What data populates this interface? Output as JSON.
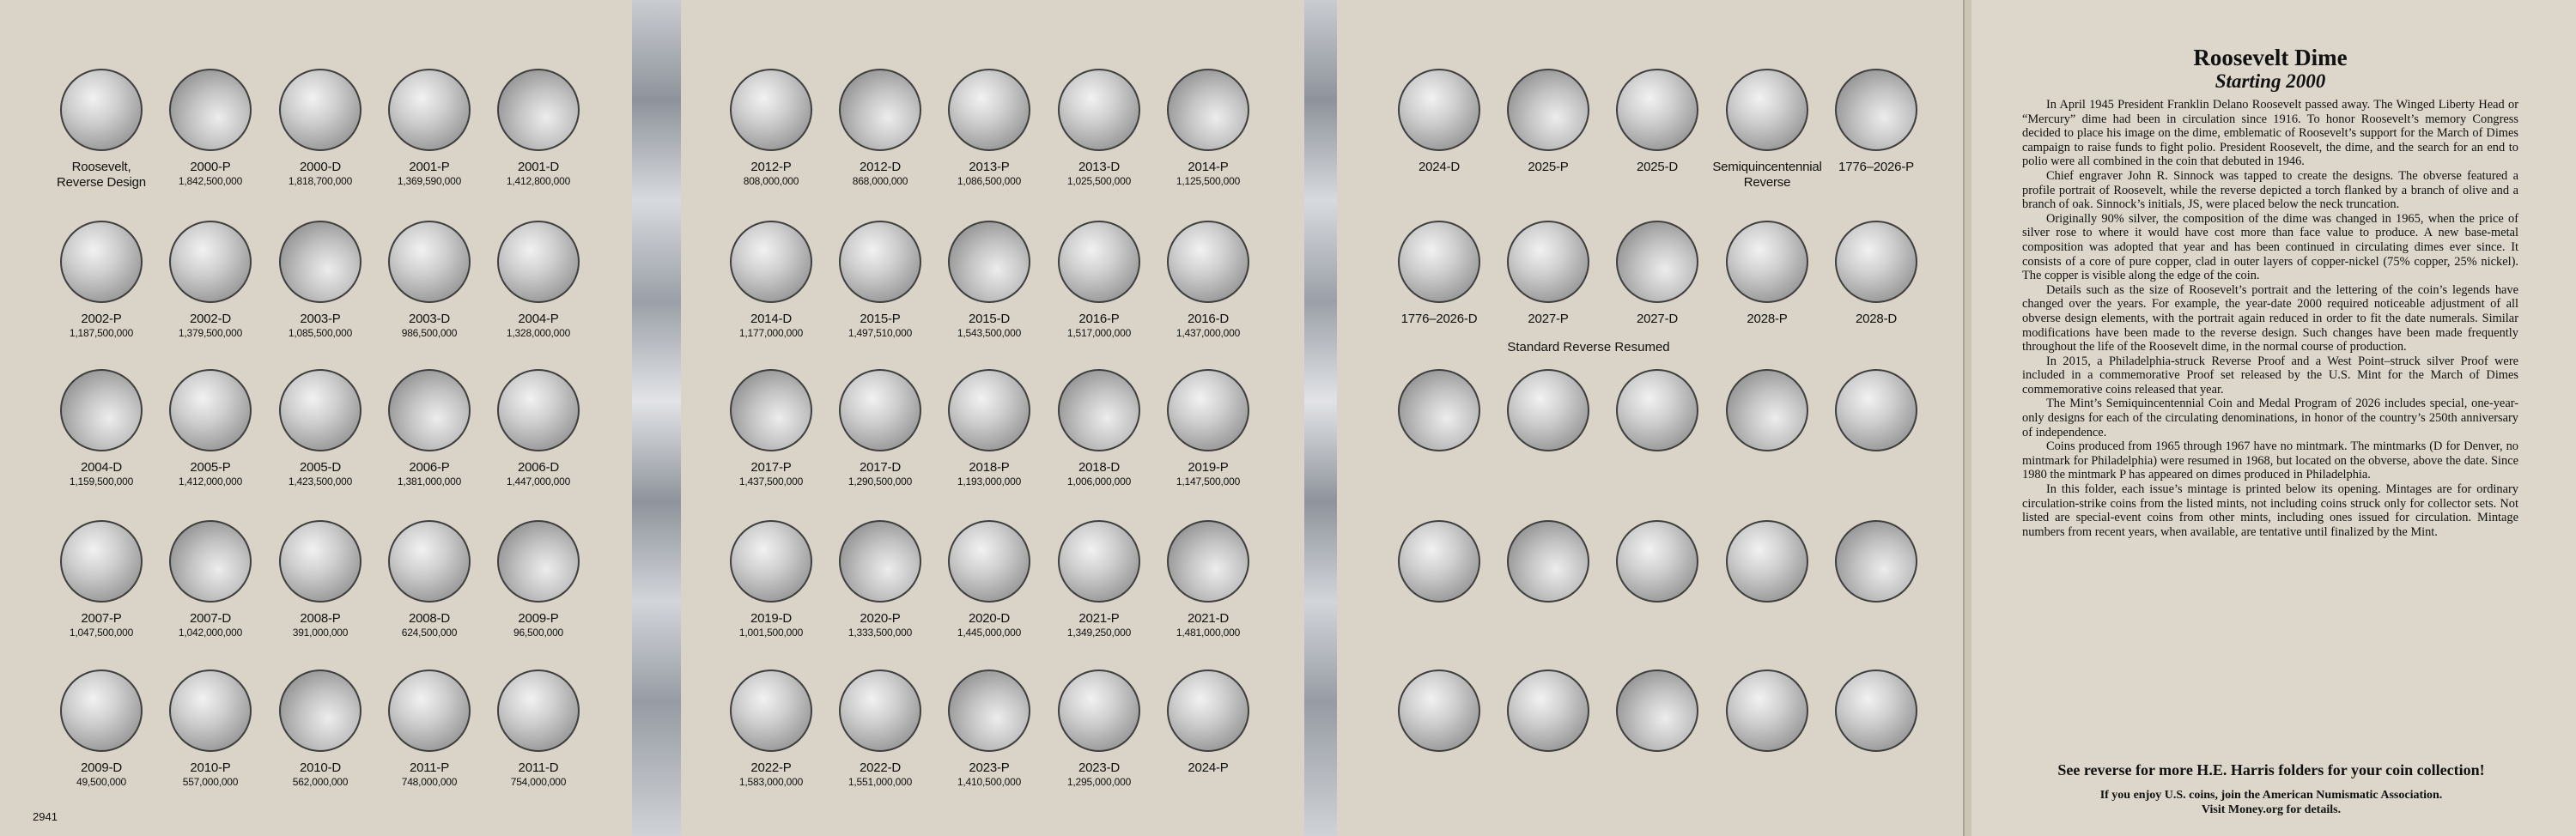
{
  "panel1": {
    "cells": [
      {
        "title": "Roosevelt,",
        "title2": "Reverse Design",
        "mintage": ""
      },
      {
        "title": "2000-P",
        "mintage": "1,842,500,000"
      },
      {
        "title": "2000-D",
        "mintage": "1,818,700,000"
      },
      {
        "title": "2001-P",
        "mintage": "1,369,590,000"
      },
      {
        "title": "2001-D",
        "mintage": "1,412,800,000"
      },
      {
        "title": "2002-P",
        "mintage": "1,187,500,000"
      },
      {
        "title": "2002-D",
        "mintage": "1,379,500,000"
      },
      {
        "title": "2003-P",
        "mintage": "1,085,500,000"
      },
      {
        "title": "2003-D",
        "mintage": "986,500,000"
      },
      {
        "title": "2004-P",
        "mintage": "1,328,000,000"
      },
      {
        "title": "2004-D",
        "mintage": "1,159,500,000"
      },
      {
        "title": "2005-P",
        "mintage": "1,412,000,000"
      },
      {
        "title": "2005-D",
        "mintage": "1,423,500,000"
      },
      {
        "title": "2006-P",
        "mintage": "1,381,000,000"
      },
      {
        "title": "2006-D",
        "mintage": "1,447,000,000"
      },
      {
        "title": "2007-P",
        "mintage": "1,047,500,000"
      },
      {
        "title": "2007-D",
        "mintage": "1,042,000,000"
      },
      {
        "title": "2008-P",
        "mintage": "391,000,000"
      },
      {
        "title": "2008-D",
        "mintage": "624,500,000"
      },
      {
        "title": "2009-P",
        "mintage": "96,500,000"
      },
      {
        "title": "2009-D",
        "mintage": "49,500,000"
      },
      {
        "title": "2010-P",
        "mintage": "557,000,000"
      },
      {
        "title": "2010-D",
        "mintage": "562,000,000"
      },
      {
        "title": "2011-P",
        "mintage": "748,000,000"
      },
      {
        "title": "2011-D",
        "mintage": "754,000,000"
      }
    ]
  },
  "panel2": {
    "cells": [
      {
        "title": "2012-P",
        "mintage": "808,000,000"
      },
      {
        "title": "2012-D",
        "mintage": "868,000,000"
      },
      {
        "title": "2013-P",
        "mintage": "1,086,500,000"
      },
      {
        "title": "2013-D",
        "mintage": "1,025,500,000"
      },
      {
        "title": "2014-P",
        "mintage": "1,125,500,000"
      },
      {
        "title": "2014-D",
        "mintage": "1,177,000,000"
      },
      {
        "title": "2015-P",
        "mintage": "1,497,510,000"
      },
      {
        "title": "2015-D",
        "mintage": "1,543,500,000"
      },
      {
        "title": "2016-P",
        "mintage": "1,517,000,000"
      },
      {
        "title": "2016-D",
        "mintage": "1,437,000,000"
      },
      {
        "title": "2017-P",
        "mintage": "1,437,500,000"
      },
      {
        "title": "2017-D",
        "mintage": "1,290,500,000"
      },
      {
        "title": "2018-P",
        "mintage": "1,193,000,000"
      },
      {
        "title": "2018-D",
        "mintage": "1,006,000,000"
      },
      {
        "title": "2019-P",
        "mintage": "1,147,500,000"
      },
      {
        "title": "2019-D",
        "mintage": "1,001,500,000"
      },
      {
        "title": "2020-P",
        "mintage": "1,333,500,000"
      },
      {
        "title": "2020-D",
        "mintage": "1,445,000,000"
      },
      {
        "title": "2021-P",
        "mintage": "1,349,250,000"
      },
      {
        "title": "2021-D",
        "mintage": "1,481,000,000"
      },
      {
        "title": "2022-P",
        "mintage": "1,583,000,000"
      },
      {
        "title": "2022-D",
        "mintage": "1,551,000,000"
      },
      {
        "title": "2023-P",
        "mintage": "1,410,500,000"
      },
      {
        "title": "2023-D",
        "mintage": "1,295,000,000"
      },
      {
        "title": "2024-P",
        "mintage": ""
      }
    ]
  },
  "panel3": {
    "cells": [
      {
        "title": "2024-D",
        "mintage": ""
      },
      {
        "title": "2025-P",
        "mintage": ""
      },
      {
        "title": "2025-D",
        "mintage": ""
      },
      {
        "title": "Semiquincentennial",
        "title2": "Reverse",
        "mintage": ""
      },
      {
        "title": "1776–2026-P",
        "mintage": ""
      },
      {
        "title": "1776–2026-D",
        "mintage": ""
      },
      {
        "title": "2027-P",
        "mintage": ""
      },
      {
        "title": "2027-D",
        "mintage": ""
      },
      {
        "title": "2028-P",
        "mintage": ""
      },
      {
        "title": "2028-D",
        "mintage": ""
      },
      {
        "title": "",
        "mintage": ""
      },
      {
        "title": "",
        "mintage": ""
      },
      {
        "title": "",
        "mintage": ""
      },
      {
        "title": "",
        "mintage": ""
      },
      {
        "title": "",
        "mintage": ""
      },
      {
        "title": "",
        "mintage": ""
      },
      {
        "title": "",
        "mintage": ""
      },
      {
        "title": "",
        "mintage": ""
      },
      {
        "title": "",
        "mintage": ""
      },
      {
        "title": "",
        "mintage": ""
      },
      {
        "title": "",
        "mintage": ""
      },
      {
        "title": "",
        "mintage": ""
      },
      {
        "title": "",
        "mintage": ""
      },
      {
        "title": "",
        "mintage": ""
      },
      {
        "title": "",
        "mintage": ""
      }
    ],
    "section_label": "Standard Reverse Resumed"
  },
  "catalog_number": "2941",
  "text_panel": {
    "title": "Roosevelt Dime",
    "subtitle": "Starting 2000",
    "paragraphs": [
      "In April 1945 President Franklin Delano Roosevelt passed away. The Winged Liberty Head or “Mercury” dime had been in circulation since 1916. To honor Roosevelt’s memory Congress decided to place his image on the dime, emblematic of Roosevelt’s support for the March of Dimes campaign to raise funds to fight polio. President Roosevelt, the dime, and the search for an end to polio were all combined in the coin that debuted in 1946.",
      "Chief engraver John R. Sinnock was tapped to create the designs. The obverse featured a profile portrait of Roosevelt, while the reverse depicted a torch flanked by a branch of olive and a branch of oak. Sinnock’s initials, JS, were placed below the neck truncation.",
      "Originally 90% silver, the composition of the dime was changed in 1965, when the price of silver rose to where it would have cost more than face value to produce. A new base-metal composition was adopted that year and has been continued in circulating dimes ever since. It consists of a core of pure copper, clad in outer layers of copper-nickel (75% copper, 25% nickel). The copper is visible along the edge of the coin.",
      "Details such as the size of Roosevelt’s portrait and the lettering of the coin’s legends have changed over the years. For example, the year-date 2000 required noticeable adjustment of all obverse design elements, with the portrait again reduced in order to fit the date numerals. Similar modifications have been made to the reverse design. Such changes have been made frequently throughout the life of the Roosevelt dime, in the normal course of production.",
      "In 2015, a Philadelphia-struck Reverse Proof and a West Point–struck silver Proof were included in a commemorative Proof set released by the U.S. Mint for the March of Dimes commemorative coins released that year.",
      "The Mint’s Semiquincentennial Coin and Medal Program of 2026 includes special, one-year-only designs for each of the circulating denominations, in honor of the country’s 250th anniversary of independence.",
      "Coins produced from 1965 through 1967 have no mintmark. The mintmarks (D for Denver, no mintmark for Philadelphia) were resumed in 1968, but located on the obverse, above the date. Since 1980 the mintmark P has appeared on dimes produced in Philadelphia.",
      "In this folder, each issue’s mintage is printed below its opening. Mintages are for ordinary circulation-strike coins from the listed mints, not including coins struck only for collector sets. Not listed are special-event coins from other mints, including ones issued for circulation. Mintage numbers from recent years, when available, are tentative until finalized by the Mint."
    ]
  },
  "footer": {
    "headline": "See reverse for more H.E. Harris folders for your coin collection!",
    "line1": "If you enjoy U.S. coins, join the American Numismatic Association.",
    "line2": "Visit Money.org for details."
  }
}
